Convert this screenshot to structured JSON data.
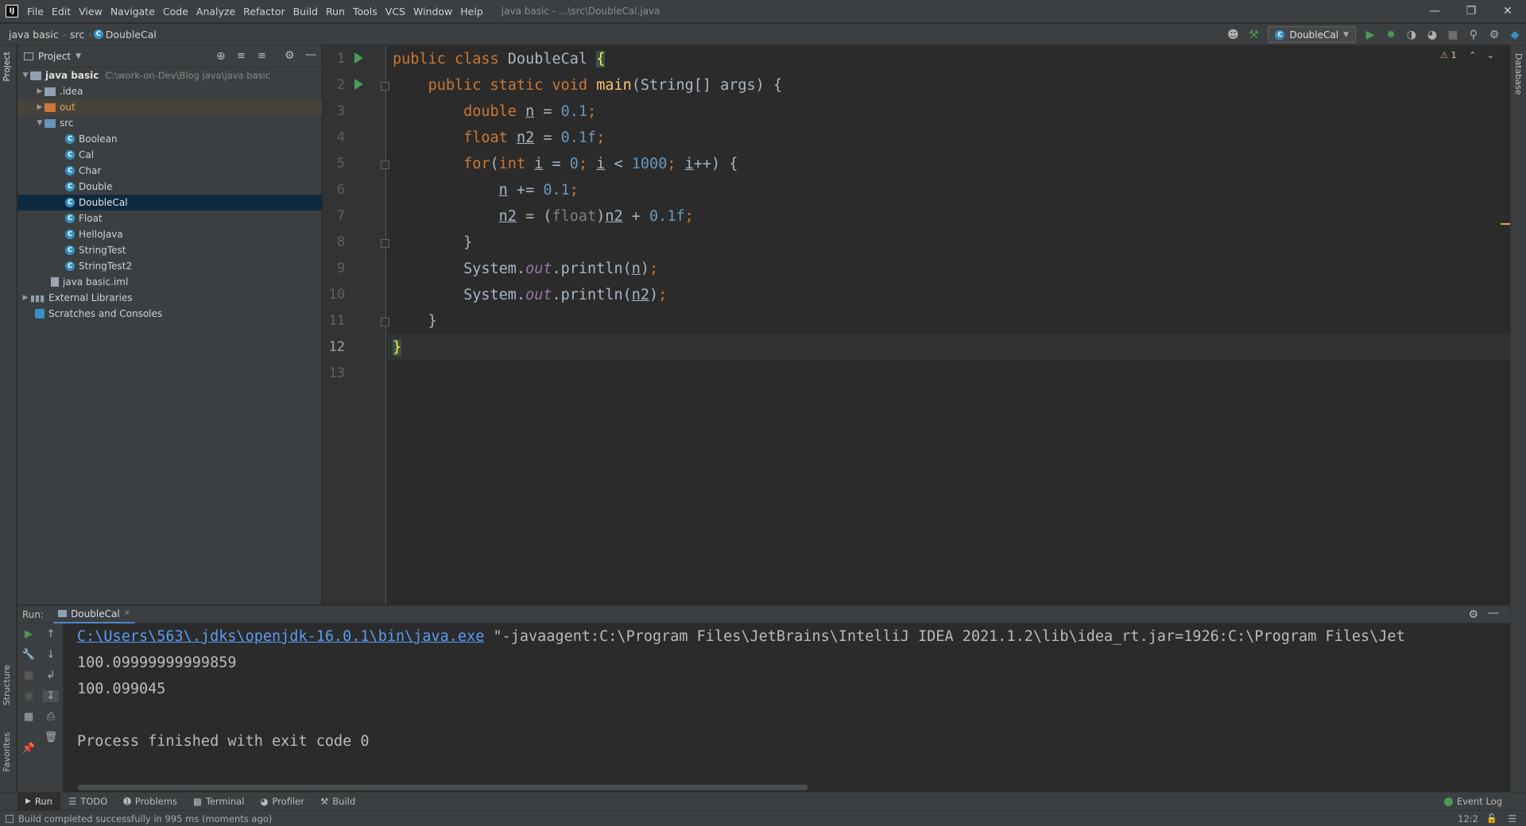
{
  "menubar": {
    "items": [
      "File",
      "Edit",
      "View",
      "Navigate",
      "Code",
      "Analyze",
      "Refactor",
      "Build",
      "Run",
      "Tools",
      "VCS",
      "Window",
      "Help"
    ],
    "window_title": "java basic - ...\\src\\DoubleCal.java"
  },
  "navbar": {
    "breadcrumbs": [
      "java basic",
      "src",
      "DoubleCal"
    ],
    "run_config": "DoubleCal",
    "warning_count": "1"
  },
  "project": {
    "title": "Project",
    "root_name": "java basic",
    "root_path": "C:\\work-on-Dev\\Blog java\\java basic",
    "items": [
      ".idea",
      "out",
      "src",
      "Boolean",
      "Cal",
      "Char",
      "Double",
      "DoubleCal",
      "Float",
      "HelloJava",
      "StringTest",
      "StringTest2",
      "java basic.iml",
      "External Libraries",
      "Scratches and Consoles"
    ]
  },
  "editor": {
    "line_numbers": [
      "1",
      "2",
      "3",
      "4",
      "5",
      "6",
      "7",
      "8",
      "9",
      "10",
      "11",
      "12",
      "13"
    ]
  },
  "side_tabs": {
    "project": "Project",
    "structure": "Structure",
    "favorites": "Favorites",
    "database": "Database"
  },
  "run": {
    "label": "Run:",
    "tab": "DoubleCal",
    "console": {
      "cmd_link": "C:\\Users\\563\\.jdks\\openjdk-16.0.1\\bin\\java.exe",
      "cmd_rest": " \"-javaagent:C:\\Program Files\\JetBrains\\IntelliJ IDEA 2021.1.2\\lib\\idea_rt.jar=1926:C:\\Program Files\\Jet",
      "out1": "100.09999999999859",
      "out2": "100.099045",
      "finish": "Process finished with exit code 0"
    }
  },
  "bottom_tabs": [
    "Run",
    "TODO",
    "Problems",
    "Terminal",
    "Profiler",
    "Build"
  ],
  "event_log": "Event Log",
  "status": {
    "message": "Build completed successfully in 995 ms (moments ago)",
    "position": "12:2"
  }
}
